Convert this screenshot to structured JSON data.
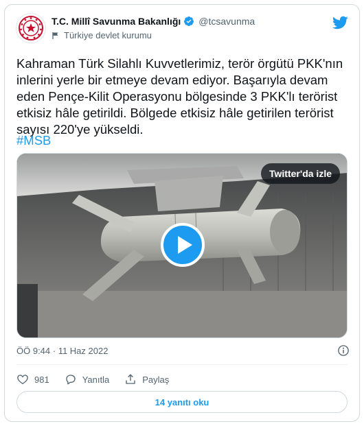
{
  "tweet": {
    "author_name": "T.C. Millî Savunma Bakanlığı",
    "handle": "@tcsavunma",
    "account_label": "Türkiye devlet kurumu",
    "text": "Kahraman Türk Silahlı Kuvvetlerimiz, terör örgütü PKK'nın\ninlerini yerle bir etmeye devam ediyor. Başarıyla devam\neden Pençe-Kilit Operasyonu bölgesinde 3 PKK'lı terörist\netkisiz hâle getirildi. Bölgede etkisiz hâle getirilen terörist\nsayısı 220'ye yükseldi.",
    "hashtag": "#MSB",
    "timestamp": "ÖÖ 9:44 · 11 Haz 2022",
    "likes": "981",
    "reply_label": "Yanıtla",
    "share_label": "Paylaş",
    "read_replies": "14 yanıtı oku"
  },
  "media": {
    "watch_label": "Twitter'da izle"
  },
  "icons": {
    "verified": "verified-badge-icon",
    "label": "flag-icon",
    "brand": "twitter-bird-icon",
    "play": "play-icon",
    "info": "info-icon",
    "like": "heart-icon",
    "reply": "reply-icon",
    "share": "share-icon"
  },
  "colors": {
    "accent": "#1d9bf0",
    "text": "#0f1419",
    "muted": "#536471",
    "border": "#cfd9de"
  }
}
